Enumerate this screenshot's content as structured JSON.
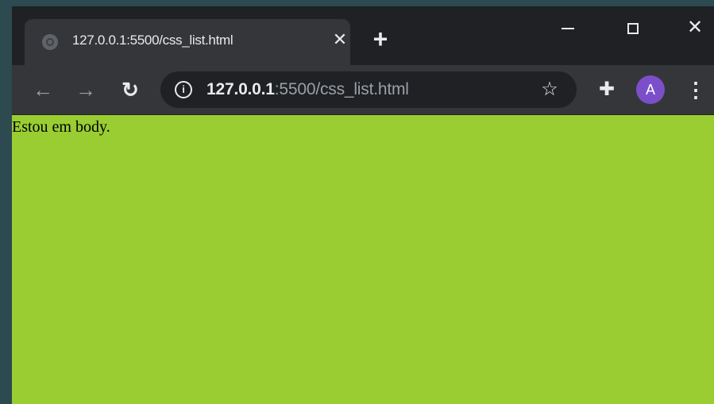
{
  "tab": {
    "title": "127.0.0.1:5500/css_list.html",
    "close_glyph": "✕",
    "favicon": "globe-icon"
  },
  "new_tab": {
    "glyph": "+"
  },
  "window_controls": {
    "minimize": "minimize-icon",
    "maximize": "maximize-icon",
    "close_glyph": "✕"
  },
  "toolbar": {
    "back_glyph": "←",
    "forward_glyph": "→",
    "reload_glyph": "↻",
    "url_host": "127.0.0.1",
    "url_rest": ":5500/css_list.html",
    "info_glyph": "i",
    "star_glyph": "☆",
    "extensions_glyph": "✚",
    "avatar_letter": "A",
    "menu_glyph": "⋮"
  },
  "page": {
    "body_text": "Estou em body.",
    "background_color": "#9acd32"
  },
  "colors": {
    "chrome_dark": "#202124",
    "chrome_toolbar": "#35363a",
    "avatar": "#7b4fc9"
  }
}
